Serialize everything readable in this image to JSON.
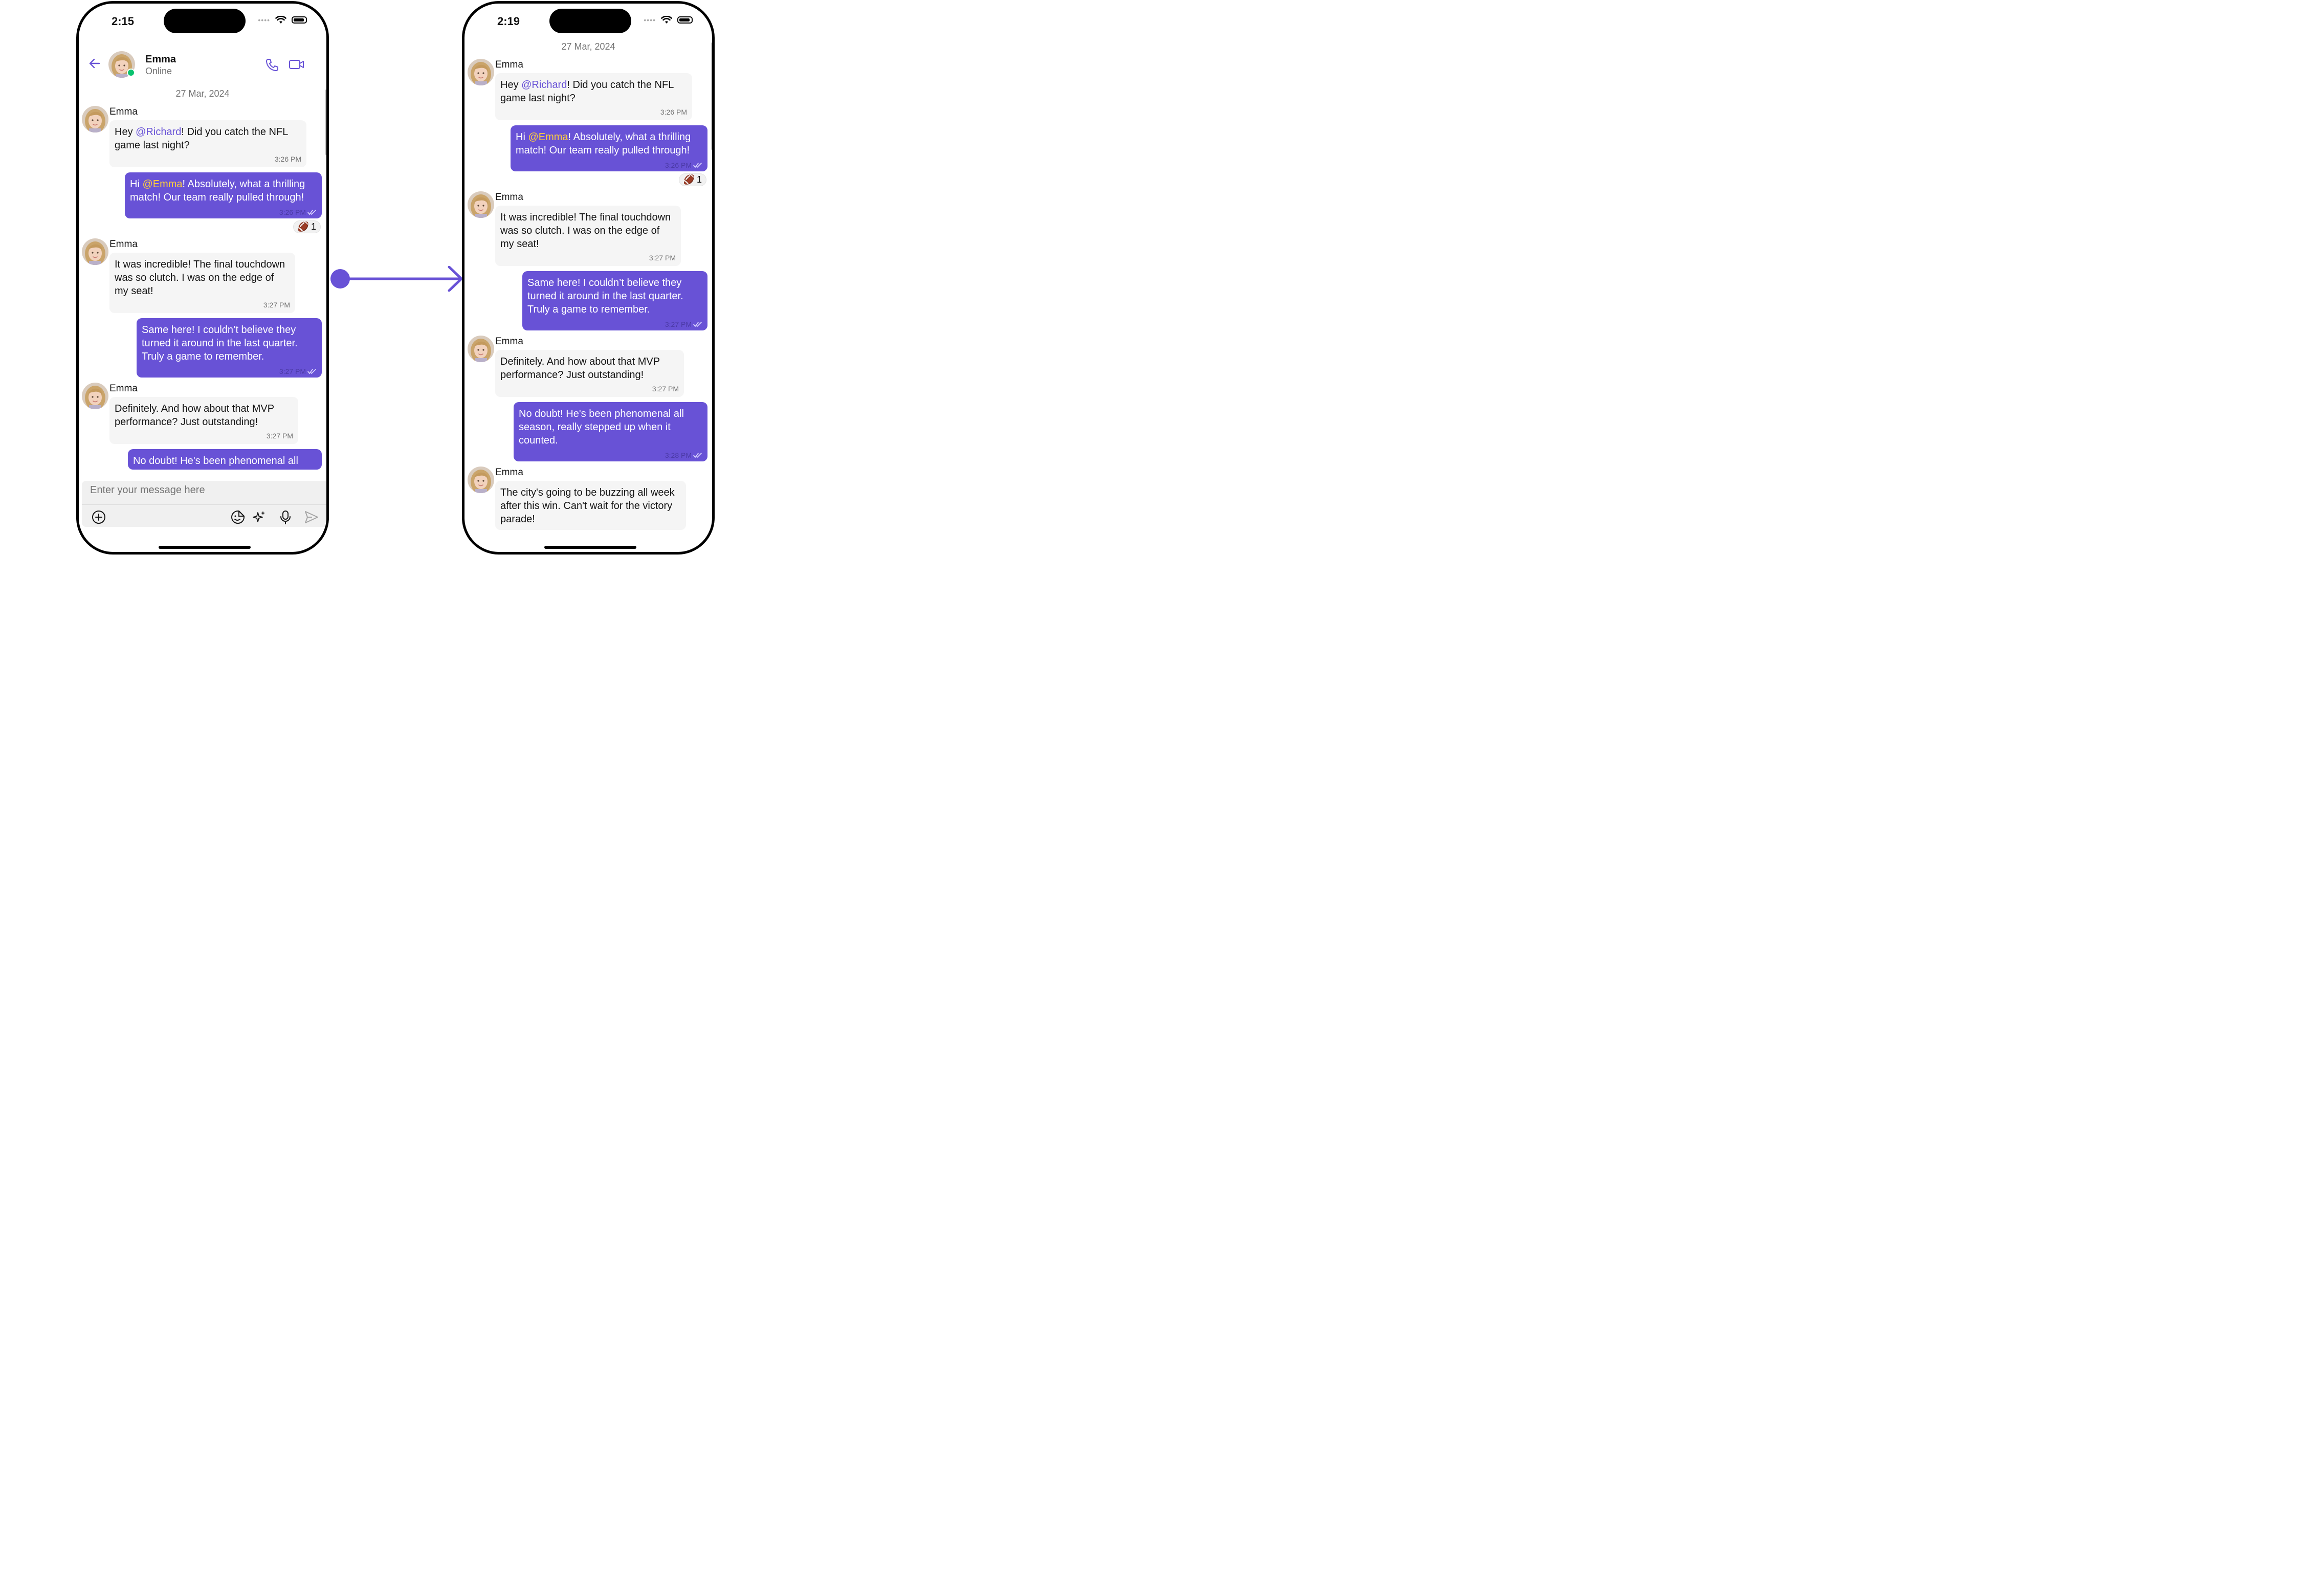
{
  "left_phone": {
    "status_time": "2:15",
    "header": {
      "name": "Emma",
      "status": "Online"
    },
    "date_separator": "27 Mar, 2024",
    "messages": [
      {
        "sender": "Emma",
        "pre": "Hey ",
        "mention": "@Richard",
        "post": "! Did you catch the NFL game last night?",
        "time": "3:26 PM"
      },
      {
        "pre": "Hi ",
        "mention": "@Emma",
        "post": "! Absolutely, what a thrilling match! Our team really pulled through!",
        "time": "3:26 PM",
        "reaction": {
          "emoji": "🏈",
          "count": "1"
        }
      },
      {
        "sender": "Emma",
        "text": "It was incredible! The final touchdown was so clutch. I was on the edge of my seat!",
        "time": "3:27 PM"
      },
      {
        "text": "Same here! I couldn’t believe they turned it around in the last quarter. Truly a game to remember.",
        "time": "3:27 PM"
      },
      {
        "sender": "Emma",
        "text": "Definitely. And how about that MVP performance? Just outstanding!",
        "time": "3:27 PM"
      },
      {
        "text": "No doubt! He's been phenomenal all"
      }
    ],
    "composer": {
      "placeholder": "Enter your message here"
    }
  },
  "right_phone": {
    "status_time": "2:19",
    "date_separator": "27 Mar, 2024",
    "messages": [
      {
        "sender": "Emma",
        "pre": "Hey ",
        "mention": "@Richard",
        "post": "! Did you catch the NFL game last night?",
        "time": "3:26 PM"
      },
      {
        "pre": "Hi ",
        "mention": "@Emma",
        "post": "! Absolutely, what a thrilling match! Our team really pulled through!",
        "time": "3:26 PM",
        "reaction": {
          "emoji": "🏈",
          "count": "1"
        }
      },
      {
        "sender": "Emma",
        "text": "It was incredible! The final touchdown was so clutch. I was on the edge of my seat!",
        "time": "3:27 PM"
      },
      {
        "text": "Same here! I couldn’t believe they turned it around in the last quarter. Truly a game to remember.",
        "time": "3:27 PM"
      },
      {
        "sender": "Emma",
        "text": "Definitely. And how about that MVP performance? Just outstanding!",
        "time": "3:27 PM"
      },
      {
        "text": "No doubt! He's been phenomenal all season, really stepped up when it counted.",
        "time": "3:28 PM"
      },
      {
        "sender": "Emma",
        "text": "The city's going to be buzzing all week after this win. Can't wait for the victory parade!"
      }
    ]
  },
  "colors": {
    "accent": "#6852d6",
    "mention_outgoing": "#ffcf3b",
    "incoming_bubble": "#f5f5f5",
    "online": "#09c26f"
  },
  "icons": [
    "back-arrow-icon",
    "phone-call-icon",
    "video-call-icon",
    "add-attachment-icon",
    "sticker-icon",
    "ai-sparkle-icon",
    "microphone-icon",
    "send-icon",
    "double-check-icon",
    "wifi-icon",
    "battery-icon"
  ]
}
